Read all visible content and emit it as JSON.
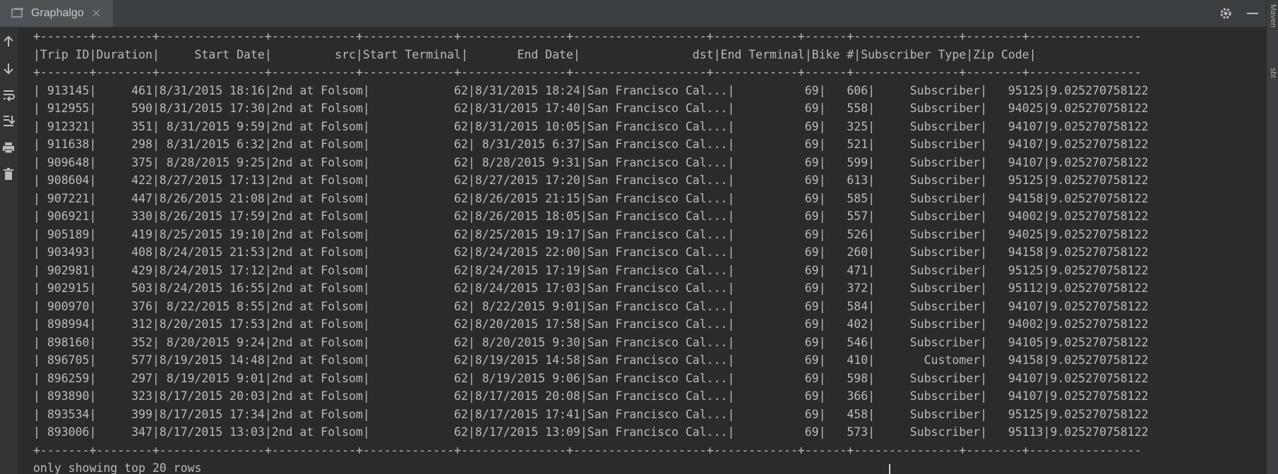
{
  "tab": {
    "title": "Graphalgo",
    "icon": "console-window-icon"
  },
  "right_panels": [
    "Maven",
    "sbt"
  ],
  "console": {
    "separator": "+-------+--------+---------------+------------+-------------+---------------+-------------------+------------+------+---------------+--------+----------------",
    "header": "|Trip ID|Duration|     Start Date|         src|Start Terminal|       End Date|                dst|End Terminal|Bike #|Subscriber Type|Zip Code|",
    "rows": [
      "| 913145|     461|8/31/2015 18:16|2nd at Folsom|            62|8/31/2015 18:24|San Francisco Cal...|          69|   606|     Subscriber|   95125|9.025270758122",
      "| 912955|     590|8/31/2015 17:30|2nd at Folsom|            62|8/31/2015 17:40|San Francisco Cal...|          69|   558|     Subscriber|   94025|9.025270758122",
      "| 912321|     351| 8/31/2015 9:59|2nd at Folsom|            62|8/31/2015 10:05|San Francisco Cal...|          69|   325|     Subscriber|   94107|9.025270758122",
      "| 911638|     298| 8/31/2015 6:32|2nd at Folsom|            62| 8/31/2015 6:37|San Francisco Cal...|          69|   521|     Subscriber|   94107|9.025270758122",
      "| 909648|     375| 8/28/2015 9:25|2nd at Folsom|            62| 8/28/2015 9:31|San Francisco Cal...|          69|   599|     Subscriber|   94107|9.025270758122",
      "| 908604|     422|8/27/2015 17:13|2nd at Folsom|            62|8/27/2015 17:20|San Francisco Cal...|          69|   613|     Subscriber|   95125|9.025270758122",
      "| 907221|     447|8/26/2015 21:08|2nd at Folsom|            62|8/26/2015 21:15|San Francisco Cal...|          69|   585|     Subscriber|   94158|9.025270758122",
      "| 906921|     330|8/26/2015 17:59|2nd at Folsom|            62|8/26/2015 18:05|San Francisco Cal...|          69|   557|     Subscriber|   94002|9.025270758122",
      "| 905189|     419|8/25/2015 19:10|2nd at Folsom|            62|8/25/2015 19:17|San Francisco Cal...|          69|   526|     Subscriber|   94025|9.025270758122",
      "| 903493|     408|8/24/2015 21:53|2nd at Folsom|            62|8/24/2015 22:00|San Francisco Cal...|          69|   260|     Subscriber|   94158|9.025270758122",
      "| 902981|     429|8/24/2015 17:12|2nd at Folsom|            62|8/24/2015 17:19|San Francisco Cal...|          69|   471|     Subscriber|   95125|9.025270758122",
      "| 902915|     503|8/24/2015 16:55|2nd at Folsom|            62|8/24/2015 17:03|San Francisco Cal...|          69|   372|     Subscriber|   95112|9.025270758122",
      "| 900970|     376| 8/22/2015 8:55|2nd at Folsom|            62| 8/22/2015 9:01|San Francisco Cal...|          69|   584|     Subscriber|   94107|9.025270758122",
      "| 898994|     312|8/20/2015 17:53|2nd at Folsom|            62|8/20/2015 17:58|San Francisco Cal...|          69|   402|     Subscriber|   94002|9.025270758122",
      "| 898160|     352| 8/20/2015 9:24|2nd at Folsom|            62| 8/20/2015 9:30|San Francisco Cal...|          69|   546|     Subscriber|   94105|9.025270758122",
      "| 896705|     577|8/19/2015 14:48|2nd at Folsom|            62|8/19/2015 14:58|San Francisco Cal...|          69|   410|       Customer|   94158|9.025270758122",
      "| 896259|     297| 8/19/2015 9:01|2nd at Folsom|            62| 8/19/2015 9:06|San Francisco Cal...|          69|   598|     Subscriber|   94107|9.025270758122",
      "| 893890|     323|8/17/2015 20:03|2nd at Folsom|            62|8/17/2015 20:08|San Francisco Cal...|          69|   366|     Subscriber|   94107|9.025270758122",
      "| 893534|     399|8/17/2015 17:34|2nd at Folsom|            62|8/17/2015 17:41|San Francisco Cal...|          69|   458|     Subscriber|   95125|9.025270758122",
      "| 893006|     347|8/17/2015 13:03|2nd at Folsom|            62|8/17/2015 13:09|San Francisco Cal...|          69|   573|     Subscriber|   95113|9.025270758122"
    ],
    "footer": "only showing top 20 rows"
  },
  "toolbar_icons": [
    "arrow-up-icon",
    "arrow-down-icon",
    "soft-wrap-icon",
    "scroll-to-end-icon",
    "print-icon",
    "trash-icon"
  ],
  "colors": {
    "background": "#2b2b2b",
    "text": "#bbbbbb",
    "panel": "#3c3f41"
  }
}
